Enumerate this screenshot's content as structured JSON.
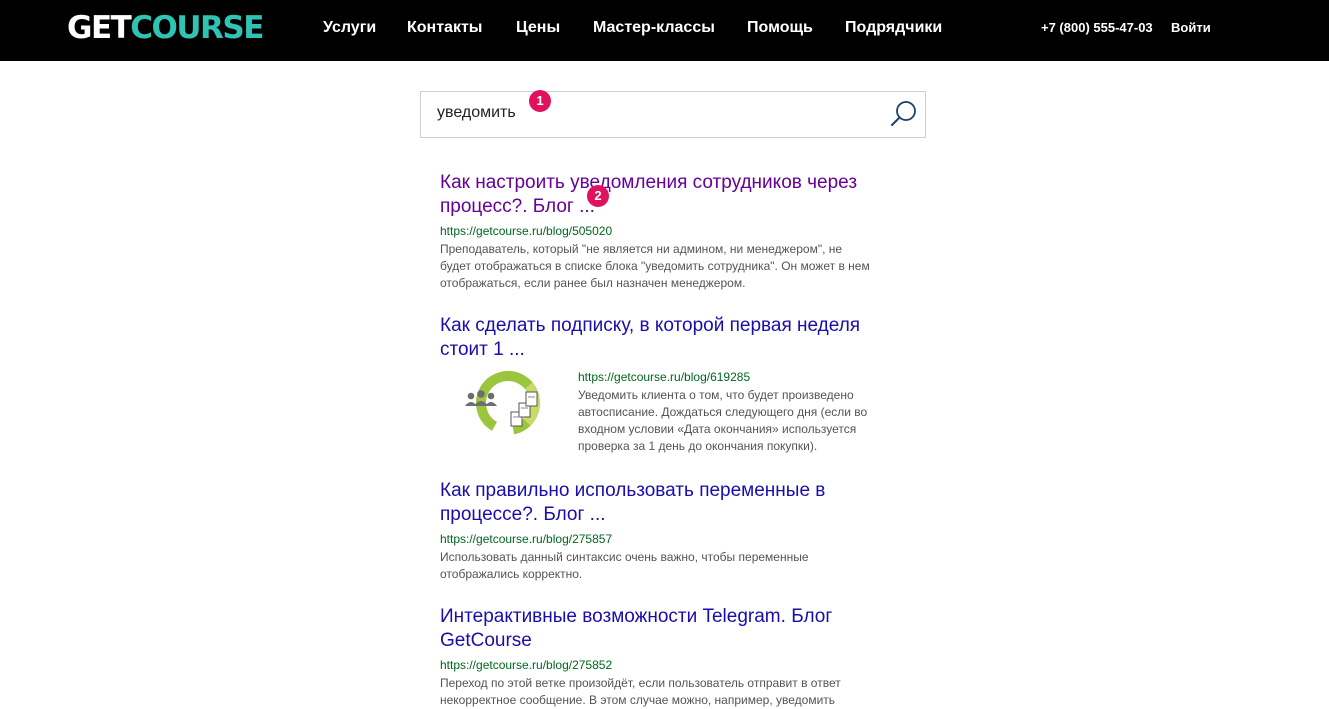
{
  "header": {
    "logo_get": "GET",
    "logo_course": "COURSE",
    "nav": [
      "Услуги",
      "Контакты",
      "Цены",
      "Мастер-классы",
      "Помощь",
      "Подрядчики"
    ],
    "phone": "+7 (800) 555-47-03",
    "login": "Войти"
  },
  "search": {
    "value": "уведомить",
    "icon": "search-icon"
  },
  "badges": [
    "1",
    "2"
  ],
  "results": [
    {
      "title_line1": "Как настроить уведомления сотрудников через",
      "title_line2": "процесс?. Блог ...",
      "url": "https://getcourse.ru/blog/505020",
      "snippet_line1": "Преподаватель, который \"не является ни админом, ни менеджером\", не",
      "snippet_line2": "будет отображаться в списке блока \"уведомить сотрудника\". Он может в нем",
      "snippet_line3": "отображаться, если ранее был назначен менеджером.",
      "visited": true
    },
    {
      "title_line1": "Как сделать подписку, в которой первая неделя",
      "title_line2": "стоит 1 ...",
      "url": "https://getcourse.ru/blog/619285",
      "snippet_line1": "Уведомить клиента о том, что будет произведено",
      "snippet_line2": "автосписание. Дождаться следующего дня (если во",
      "snippet_line3": "входном условии «Дата окончания» используется",
      "snippet_line4": "проверка за 1 день до окончания покупки).",
      "thumbnail": "subscription-cycle-image"
    },
    {
      "title_line1": "Как правильно использовать переменные в",
      "title_line2": "процессе?. Блог ...",
      "url": "https://getcourse.ru/blog/275857",
      "snippet_line1": "Использовать данный синтаксис очень важно, чтобы переменные",
      "snippet_line2": "отображались корректно."
    },
    {
      "title_line1": "Интерактивные возможности Telegram. Блог",
      "title_line2": "GetCourse",
      "url": "https://getcourse.ru/blog/275852",
      "snippet_line1": "Переход по этой ветке произойдёт, если пользователь отправит в ответ",
      "snippet_line2": "некорректное сообщение. В этом случае можно, например, уведомить"
    }
  ],
  "colors": {
    "header_bg": "#000000",
    "logo_accent": "#2ec3b3",
    "link": "#1a0dab",
    "visited_link": "#660099",
    "url_green": "#006621",
    "badge": "#e0115f"
  }
}
